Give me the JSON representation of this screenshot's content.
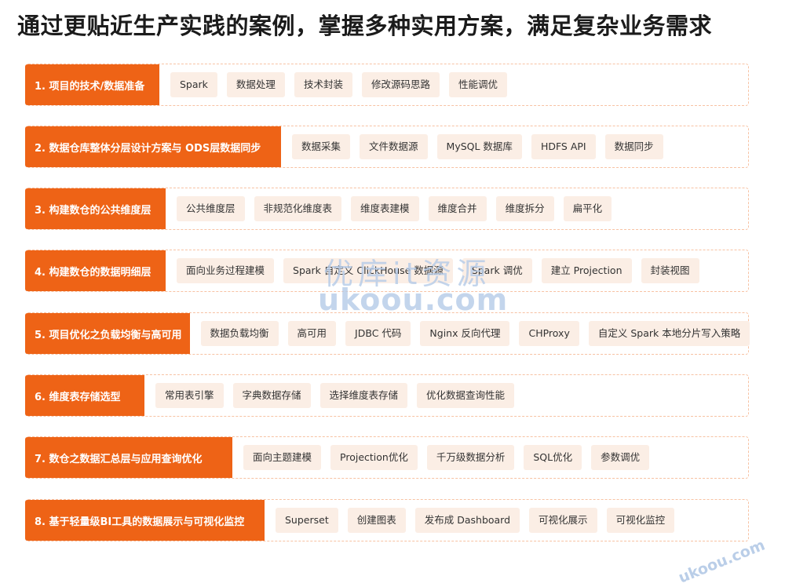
{
  "title": "通过更贴近生产实践的案例，掌握多种实用方案，满足复杂业务需求",
  "rows": [
    {
      "label": "1. 项目的技术/数据准备",
      "chips": [
        "Spark",
        "数据处理",
        "技术封装",
        "修改源码思路",
        "性能调优"
      ]
    },
    {
      "label": "2. 数据仓库整体分层设计方案与 ODS层数据同步",
      "chips": [
        "数据采集",
        "文件数据源",
        "MySQL 数据库",
        "HDFS API",
        "数据同步"
      ]
    },
    {
      "label": "3. 构建数仓的公共维度层",
      "chips": [
        "公共维度层",
        "非规范化维度表",
        "维度表建模",
        "维度合并",
        "维度拆分",
        "扁平化"
      ]
    },
    {
      "label": "4. 构建数仓的数据明细层",
      "chips": [
        "面向业务过程建模",
        "Spark 自定义 ClickHouse 数据源",
        "Spark 调优",
        "建立 Projection",
        "封装视图"
      ]
    },
    {
      "label": "5. 项目优化之负载均衡与高可用",
      "chips": [
        "数据负载均衡",
        "高可用",
        "JDBC 代码",
        "Nginx 反向代理",
        "CHProxy",
        "自定义 Spark 本地分片写入策略"
      ]
    },
    {
      "label": "6. 维度表存储选型",
      "chips": [
        "常用表引擎",
        "字典数据存储",
        "选择维度表存储",
        "优化数据查询性能"
      ]
    },
    {
      "label": "7. 数仓之数据汇总层与应用查询优化",
      "chips": [
        "面向主题建模",
        "Projection优化",
        "千万级数据分析",
        "SQL优化",
        "参数调优"
      ]
    },
    {
      "label": "8. 基于轻量级BI工具的数据展示与可视化监控",
      "chips": [
        "Superset",
        "创建图表",
        "发布成 Dashboard",
        "可视化展示",
        "可视化监控"
      ]
    }
  ],
  "watermark": {
    "cn": "优库it资源",
    "url": "ukoou.com",
    "corner": "ukoou.com"
  },
  "colors": {
    "accent": "#ee6316",
    "chip_bg": "#fbeee5",
    "border": "#f7c2a3"
  }
}
